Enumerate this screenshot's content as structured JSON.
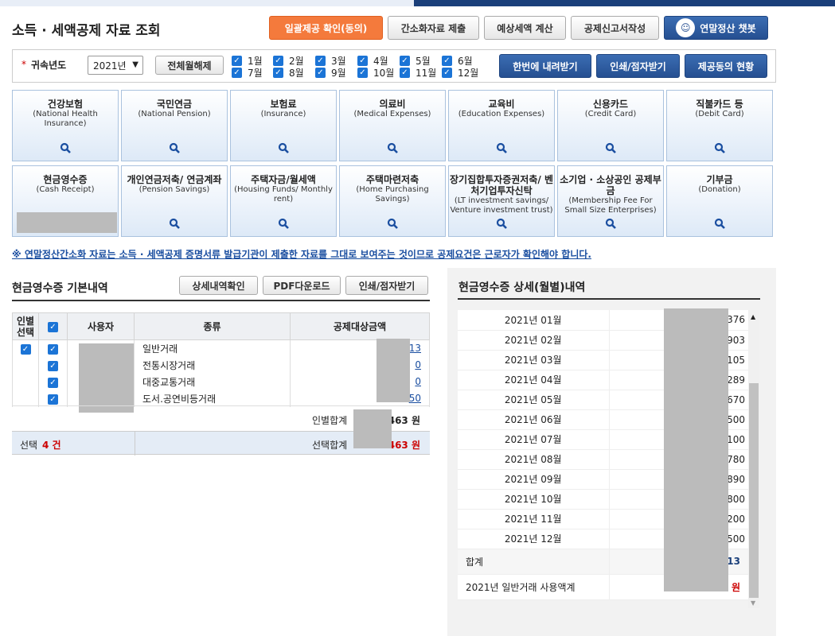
{
  "header": {
    "title": "소득 · 세액공제 자료 조회",
    "buttons": [
      "일괄제공 확인(동의)",
      "간소화자료 제출",
      "예상세액 계산",
      "공제신고서작성",
      "연말정산 챗봇"
    ]
  },
  "filter": {
    "label": "귀속년도",
    "year": "2021년",
    "clear_all": "전체월해제",
    "months_row1": [
      "1월",
      "2월",
      "3월",
      "4월",
      "5월",
      "6월"
    ],
    "months_row2": [
      "7월",
      "8월",
      "9월",
      "10월",
      "11월",
      "12월"
    ],
    "buttons": [
      "한번에 내려받기",
      "인쇄/점자받기",
      "제공동의 현황"
    ]
  },
  "tiles_row1": [
    {
      "ko": "건강보험",
      "en": "(National Health Insurance)"
    },
    {
      "ko": "국민연금",
      "en": "(National Pension)"
    },
    {
      "ko": "보험료",
      "en": "(Insurance)"
    },
    {
      "ko": "의료비",
      "en": "(Medical Expenses)"
    },
    {
      "ko": "교육비",
      "en": "(Education Expenses)"
    },
    {
      "ko": "신용카드",
      "en": "(Credit Card)"
    },
    {
      "ko": "직불카드 등",
      "en": "(Debit Card)"
    }
  ],
  "tiles_row2": [
    {
      "ko": "현금영수증",
      "en": "(Cash Receipt)"
    },
    {
      "ko": "개인연금저축/ 연금계좌",
      "en": "(Pension Savings)"
    },
    {
      "ko": "주택자금/월세액",
      "en": "(Housing Funds/ Monthly rent)"
    },
    {
      "ko": "주택마련저축",
      "en": "(Home Purchasing Savings)"
    },
    {
      "ko": "장기집합투자증권저축/ 벤처기업투자신탁",
      "en": "(LT investment savings/ Venture investment trust)"
    },
    {
      "ko": "소기업 · 소상공인 공제부금",
      "en": "(Membership Fee For Small Size Enterprises)"
    },
    {
      "ko": "기부금",
      "en": "(Donation)"
    }
  ],
  "notice": "※ 연말정산간소화 자료는 소득 · 세액공제 증명서류 발급기관이 제출한 자료를 그대로 보여주는 것이므로 공제요건은 근로자가 확인해야 합니다.",
  "left": {
    "title": "현금영수증 기본내역",
    "buttons": [
      "상세내역확인",
      "PDF다운로드",
      "인쇄/점자받기"
    ],
    "headers": {
      "person_select": "인별 선택",
      "user": "사용자",
      "type": "종류",
      "amount": "공제대상금액"
    },
    "rows": [
      {
        "type": "일반거래",
        "amount": "13"
      },
      {
        "type": "전통시장거래",
        "amount": "0"
      },
      {
        "type": "대중교통거래",
        "amount": "0"
      },
      {
        "type": "도서.공연비등거래",
        "amount": "50"
      }
    ],
    "person_total_label": "인별합계",
    "person_total": "463 원",
    "selected_label": "선택",
    "selected_count": "4 건",
    "selected_total_label": "선택합계",
    "selected_total": "463 원"
  },
  "right": {
    "title": "현금영수증 상세(월별)내역",
    "months": [
      {
        "m": "2021년 01월",
        "v": "376"
      },
      {
        "m": "2021년 02월",
        "v": "903"
      },
      {
        "m": "2021년 03월",
        "v": "105"
      },
      {
        "m": "2021년 04월",
        "v": "289"
      },
      {
        "m": "2021년 05월",
        "v": "670"
      },
      {
        "m": "2021년 06월",
        "v": "500"
      },
      {
        "m": "2021년 07월",
        "v": "100"
      },
      {
        "m": "2021년 08월",
        "v": "780"
      },
      {
        "m": "2021년 09월",
        "v": "890"
      },
      {
        "m": "2021년 10월",
        "v": "800"
      },
      {
        "m": "2021년 11월",
        "v": "200"
      },
      {
        "m": "2021년 12월",
        "v": "500"
      }
    ],
    "total_label": "합계",
    "total": "13",
    "usage_label": "2021년 일반거래 사용액계",
    "usage": "원"
  }
}
